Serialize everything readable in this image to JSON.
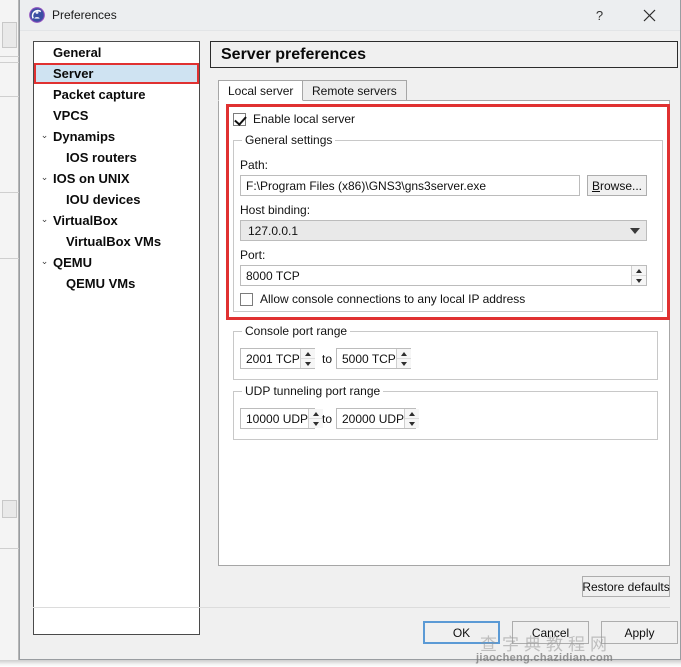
{
  "window": {
    "title": "Preferences",
    "icon": "gns3-app-icon",
    "help_label": "?",
    "close_label": "✕"
  },
  "sidebar": {
    "items": [
      {
        "label": "General",
        "level": "root",
        "expandable": false,
        "selected": false
      },
      {
        "label": "Server",
        "level": "root",
        "expandable": false,
        "selected": true
      },
      {
        "label": "Packet capture",
        "level": "root",
        "expandable": false,
        "selected": false
      },
      {
        "label": "VPCS",
        "level": "root",
        "expandable": false,
        "selected": false
      },
      {
        "label": "Dynamips",
        "level": "root",
        "expandable": true,
        "selected": false
      },
      {
        "label": "IOS routers",
        "level": "child",
        "expandable": false,
        "selected": false
      },
      {
        "label": "IOS on UNIX",
        "level": "root",
        "expandable": true,
        "selected": false
      },
      {
        "label": "IOU devices",
        "level": "child",
        "expandable": false,
        "selected": false
      },
      {
        "label": "VirtualBox",
        "level": "root",
        "expandable": true,
        "selected": false
      },
      {
        "label": "VirtualBox VMs",
        "level": "child",
        "expandable": false,
        "selected": false
      },
      {
        "label": "QEMU",
        "level": "root",
        "expandable": true,
        "selected": false
      },
      {
        "label": "QEMU VMs",
        "level": "child",
        "expandable": false,
        "selected": false
      }
    ],
    "expand_glyph": "⌄"
  },
  "panel": {
    "title": "Server preferences",
    "tabs": [
      {
        "label": "Local server",
        "active": true
      },
      {
        "label": "Remote servers",
        "active": false
      }
    ]
  },
  "local_server": {
    "enable_checkbox_label": "Enable local server",
    "enable_checkbox_checked": true,
    "general_settings_title": "General settings",
    "path_label": "Path:",
    "path_value": "F:\\Program Files (x86)\\GNS3\\gns3server.exe",
    "browse_label_mnemonic": "B",
    "browse_label_rest": "rowse...",
    "host_binding_label": "Host binding:",
    "host_binding_value": "127.0.0.1",
    "port_label": "Port:",
    "port_value": "8000 TCP",
    "allow_console_label": "Allow console connections to any local IP address",
    "allow_console_checked": false
  },
  "console_port_range": {
    "title": "Console port range",
    "from_value": "2001 TCP",
    "to_label": "to",
    "to_value": "5000 TCP"
  },
  "udp_tunneling_port_range": {
    "title": "UDP tunneling port range",
    "from_value": "10000 UDP",
    "to_label": "to",
    "to_value": "20000 UDP"
  },
  "buttons": {
    "restore_defaults": "Restore defaults",
    "ok": "OK",
    "cancel": "Cancel",
    "apply": "Apply"
  },
  "watermark": {
    "cn": "查字典教程网",
    "url": "jiaocheng.chazidian.com"
  },
  "colors": {
    "highlight_red": "#e03131",
    "selection_blue": "#cfe3f2",
    "default_button_border": "#5b9ad5"
  }
}
